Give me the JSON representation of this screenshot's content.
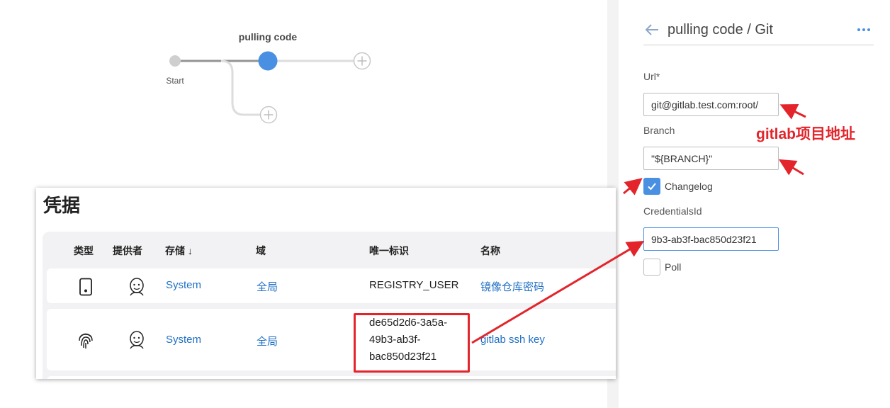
{
  "pipeline": {
    "stage_title": "pulling code",
    "start_label": "Start"
  },
  "panel": {
    "title": "pulling code / Git",
    "url": {
      "label": "Url*",
      "value": "git@gitlab.test.com:root/"
    },
    "branch": {
      "label": "Branch",
      "value": "\"${BRANCH}\""
    },
    "changelog": {
      "label": "Changelog",
      "checked": true
    },
    "credentials_id": {
      "label": "CredentialsId",
      "value": "9b3-ab3f-bac850d23f21"
    },
    "poll": {
      "label": "Poll",
      "checked": false
    }
  },
  "credentials": {
    "title": "凭据",
    "columns": [
      "类型",
      "提供者",
      "存储 ↓",
      "域",
      "唯一标识",
      "名称"
    ],
    "rows": [
      {
        "type_icon": "phone-icon",
        "provider_icon": "jenkins-icon",
        "store": "System",
        "domain": "全局",
        "uid": "REGISTRY_USER",
        "name": "镜像仓库密码"
      },
      {
        "type_icon": "fingerprint-icon",
        "provider_icon": "jenkins-icon",
        "store": "System",
        "domain": "全局",
        "uid": "de65d2d6-3a5a-49b3-ab3f-bac850d23f21",
        "name": "gitlab ssh key"
      }
    ]
  },
  "annotation": {
    "text": "gitlab项目地址",
    "color": "#e3242b"
  },
  "colors": {
    "accent": "#4a90e2",
    "link": "#1f6fc5"
  }
}
